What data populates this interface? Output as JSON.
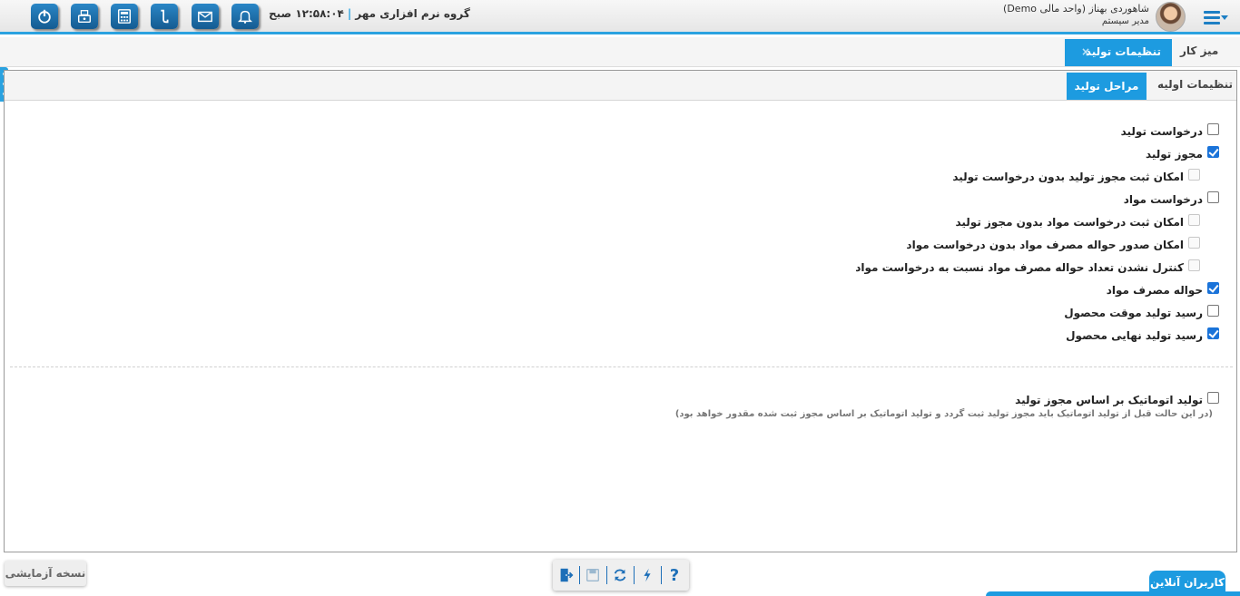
{
  "header": {
    "user_name": "شاهوردی بهناز (واحد مالی Demo)",
    "user_role": "مدیر سیستم",
    "company": "گروه نرم افزاری مهر",
    "clock": "۱۲:۵۸:۰۴ صبح",
    "accent": "#2aa2e0",
    "icons": [
      "power-icon",
      "cashier-icon",
      "calculator-icon",
      "phone-icon",
      "mail-icon",
      "bell-icon"
    ]
  },
  "tabs": {
    "home": "میز کار",
    "active": "تنظیمات تولید",
    "close": "×"
  },
  "subtabs": {
    "basic": "تنظیمات اولیه",
    "active": "مراحل تولید"
  },
  "options": [
    {
      "label": "درخواست تولید",
      "checked": false,
      "disabled": false,
      "indent": false
    },
    {
      "label": "مجوز تولید",
      "checked": true,
      "disabled": false,
      "indent": false
    },
    {
      "label": "امکان ثبت مجوز تولید بدون درخواست تولید",
      "checked": false,
      "disabled": true,
      "indent": true
    },
    {
      "label": "درخواست مواد",
      "checked": false,
      "disabled": false,
      "indent": false
    },
    {
      "label": "امکان ثبت درخواست مواد بدون مجوز تولید",
      "checked": false,
      "disabled": true,
      "indent": true
    },
    {
      "label": "امکان صدور حواله مصرف مواد بدون درخواست مواد",
      "checked": false,
      "disabled": true,
      "indent": true
    },
    {
      "label": "کنترل نشدن تعداد حواله مصرف مواد نسبت به درخواست مواد",
      "checked": false,
      "disabled": true,
      "indent": true
    },
    {
      "label": "حواله مصرف مواد",
      "checked": true,
      "disabled": false,
      "indent": false
    },
    {
      "label": "رسید تولید موقت محصول",
      "checked": false,
      "disabled": false,
      "indent": false
    },
    {
      "label": "رسید تولید نهایی محصول",
      "checked": true,
      "disabled": false,
      "indent": false
    }
  ],
  "auto_production": {
    "label": "تولید اتوماتیک بر اساس مجوز تولید",
    "checked": false,
    "note": "(در این حالت قبل از تولید اتوماتیک باید مجوز تولید ثبت گردد و تولید اتوماتیک بر اساس مجوز ثبت شده مقدور خواهد بود)"
  },
  "footer": {
    "demo_badge": "نسخه آزمایشی",
    "online_users": "کاربران آنلاین",
    "toolbar": [
      "help-icon",
      "flash-icon",
      "refresh-icon",
      "save-icon",
      "exit-icon"
    ],
    "help_glyph": "?"
  }
}
